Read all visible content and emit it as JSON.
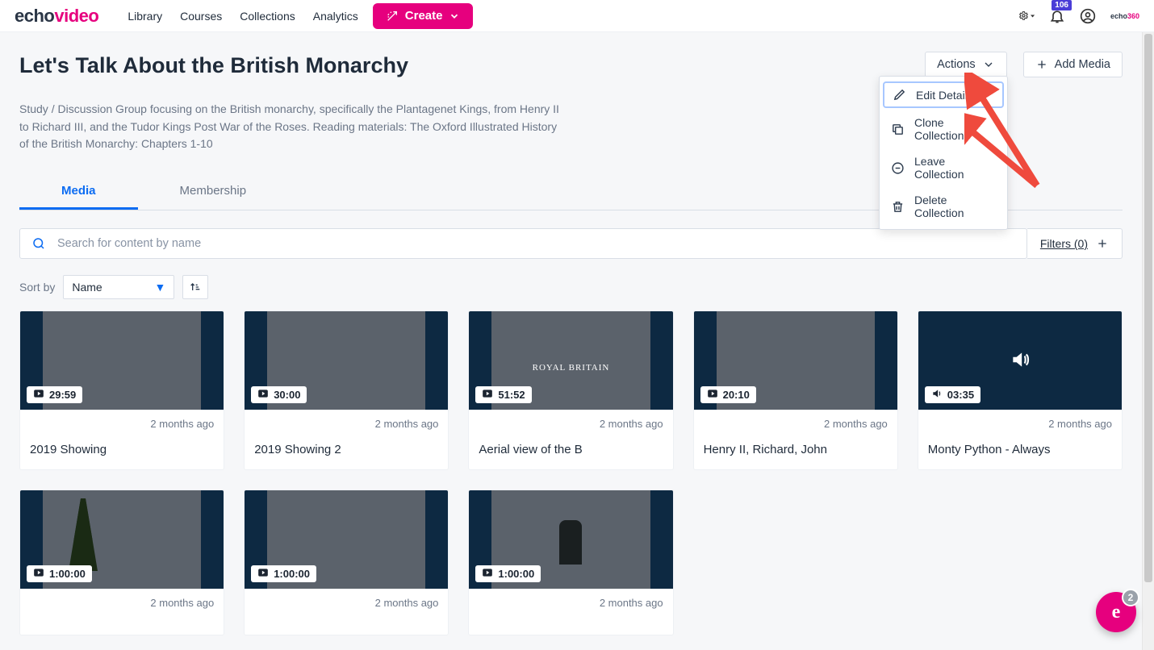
{
  "topnav": {
    "items": [
      "Library",
      "Courses",
      "Collections",
      "Analytics"
    ],
    "create": "Create",
    "notification_count": "106"
  },
  "logo": {
    "part1": "echo",
    "part2": "video"
  },
  "page": {
    "title": "Let's Talk About the British Monarchy",
    "description": "Study / Discussion Group focusing on the British monarchy, specifically the Plantagenet Kings, from Henry II to Richard III, and the Tudor Kings Post War of the Roses. Reading materials: The Oxford Illustrated History of the British Monarchy: Chapters 1-10"
  },
  "buttons": {
    "actions": "Actions",
    "add_media": "Add Media"
  },
  "actions_menu": {
    "edit": "Edit Details",
    "clone": "Clone Collection",
    "leave": "Leave Collection",
    "delete": "Delete Collection"
  },
  "tabs": {
    "media": "Media",
    "membership": "Membership"
  },
  "search": {
    "placeholder": "Search for content by name"
  },
  "filters": {
    "label": "Filters (0)"
  },
  "sort": {
    "label": "Sort by",
    "value": "Name"
  },
  "cards": [
    {
      "duration": "29:59",
      "ago": "2 months ago",
      "title": "2019 Showing",
      "type": "video",
      "thumb": "t0"
    },
    {
      "duration": "30:00",
      "ago": "2 months ago",
      "title": "2019 Showing 2",
      "type": "video",
      "thumb": "t1"
    },
    {
      "duration": "51:52",
      "ago": "2 months ago",
      "title": "Aerial view of the B",
      "type": "video",
      "thumb": "t2"
    },
    {
      "duration": "20:10",
      "ago": "2 months ago",
      "title": "Henry II, Richard, John",
      "type": "video",
      "thumb": "t3"
    },
    {
      "duration": "03:35",
      "ago": "2 months ago",
      "title": "Monty Python - Always",
      "type": "audio",
      "thumb": "t4"
    },
    {
      "duration": "1:00:00",
      "ago": "2 months ago",
      "title": "",
      "type": "video",
      "thumb": "t5"
    },
    {
      "duration": "1:00:00",
      "ago": "2 months ago",
      "title": "",
      "type": "video",
      "thumb": "t6"
    },
    {
      "duration": "1:00:00",
      "ago": "2 months ago",
      "title": "",
      "type": "video",
      "thumb": "t7"
    }
  ],
  "fab": {
    "count": "2"
  }
}
